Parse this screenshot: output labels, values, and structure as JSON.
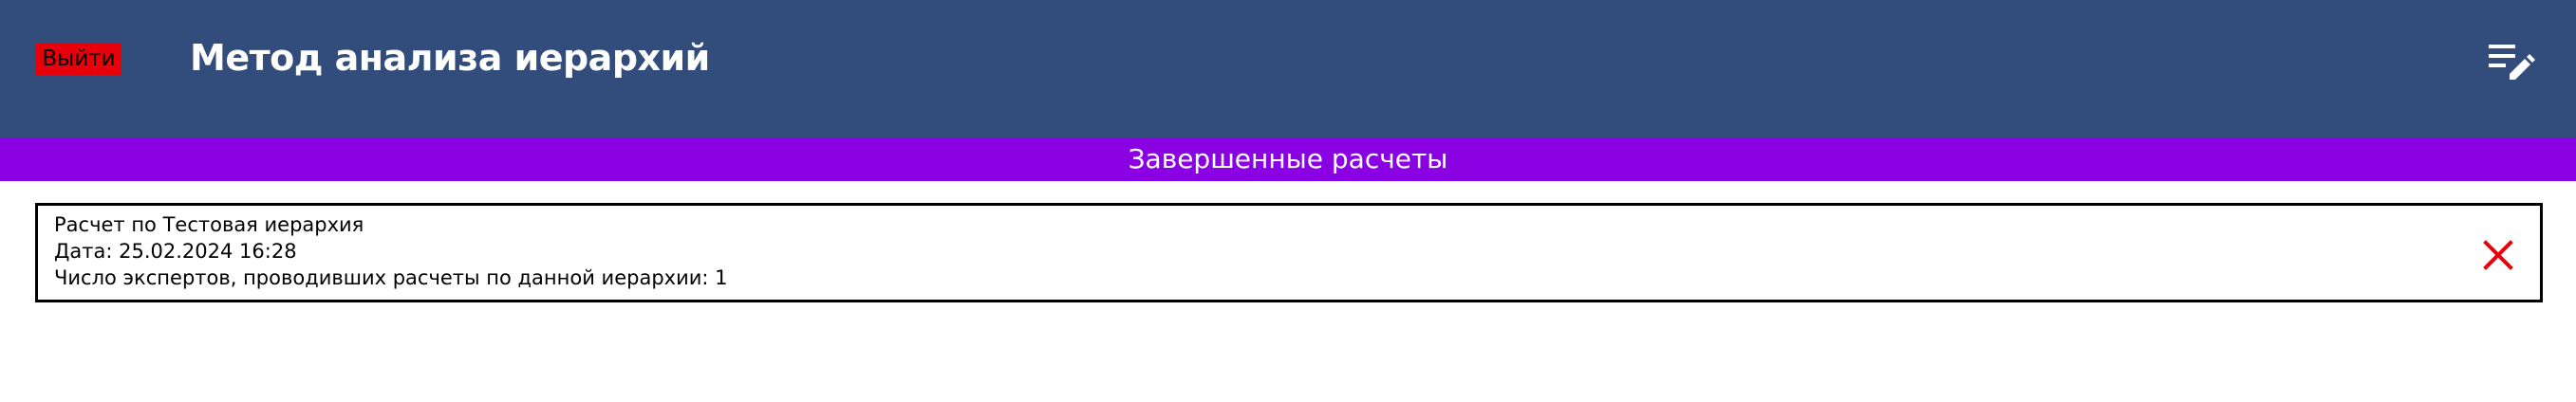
{
  "header": {
    "logout_label": "Выйти",
    "title": "Метод анализа иерархий",
    "edit_icon": "playlist-edit-icon"
  },
  "section": {
    "title": "Завершенные расчеты"
  },
  "calculations": [
    {
      "line1": "Расчет по Тестовая иерархия",
      "line2": "Дата: 25.02.2024 16:28",
      "line3": "Число экспертов, проводивших расчеты по данной иерархии: 1",
      "delete_icon": "close-icon"
    }
  ],
  "colors": {
    "header_bg": "#324c7b",
    "section_bg": "#8a02e4",
    "logout_bg": "#e8000a",
    "delete_icon": "#e8000a"
  }
}
